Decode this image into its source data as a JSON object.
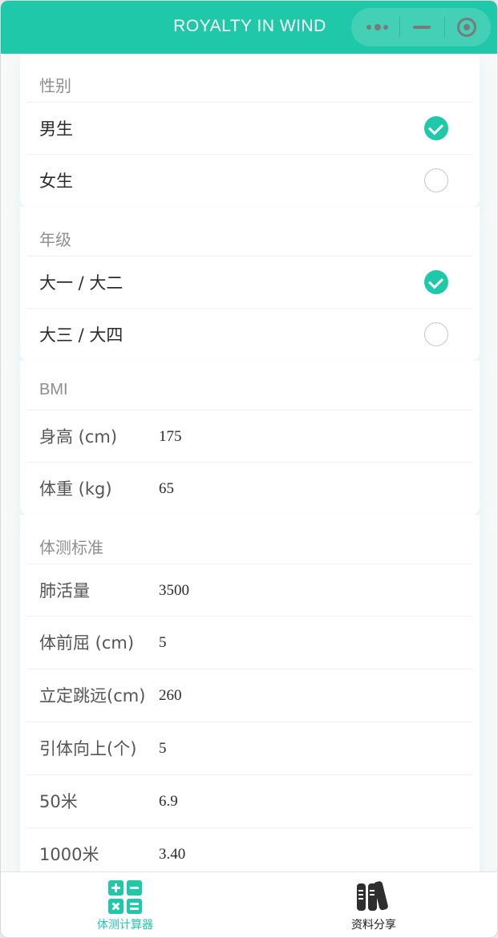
{
  "app": {
    "title": "ROYALTY IN WIND"
  },
  "colors": {
    "accent": "#1fc8a8",
    "text": "#2b2b2b",
    "header_text": "#8e8e8e"
  },
  "capsule": {
    "icons": [
      "more-dots-icon",
      "minimize-icon",
      "close-target-icon"
    ]
  },
  "gender": {
    "header": "性别",
    "options": [
      {
        "label": "男生",
        "checked": true
      },
      {
        "label": "女生",
        "checked": false
      }
    ]
  },
  "grade": {
    "header": "年级",
    "options": [
      {
        "label": "大一 / 大二",
        "checked": true
      },
      {
        "label": "大三 / 大四",
        "checked": false
      }
    ]
  },
  "bmi": {
    "header": "BMI",
    "fields": [
      {
        "label": "身高 (cm)",
        "value": "175"
      },
      {
        "label": "体重 (kg)",
        "value": "65"
      }
    ]
  },
  "standards": {
    "header": "体测标准",
    "fields": [
      {
        "label": "肺活量",
        "value": "3500"
      },
      {
        "label": "体前屈 (cm)",
        "value": "5"
      },
      {
        "label": "立定跳远(cm)",
        "value": "260"
      },
      {
        "label": "引体向上(个)",
        "value": "5"
      },
      {
        "label": "50米",
        "value": "6.9"
      },
      {
        "label": "1000米",
        "value": "3.40"
      }
    ]
  },
  "tabbar": {
    "tabs": [
      {
        "label": "体测计算器",
        "icon": "calculator-icon",
        "active": true,
        "color": "#1fc8a8"
      },
      {
        "label": "资料分享",
        "icon": "books-icon",
        "active": false,
        "color": "#1a1a1a"
      }
    ]
  }
}
